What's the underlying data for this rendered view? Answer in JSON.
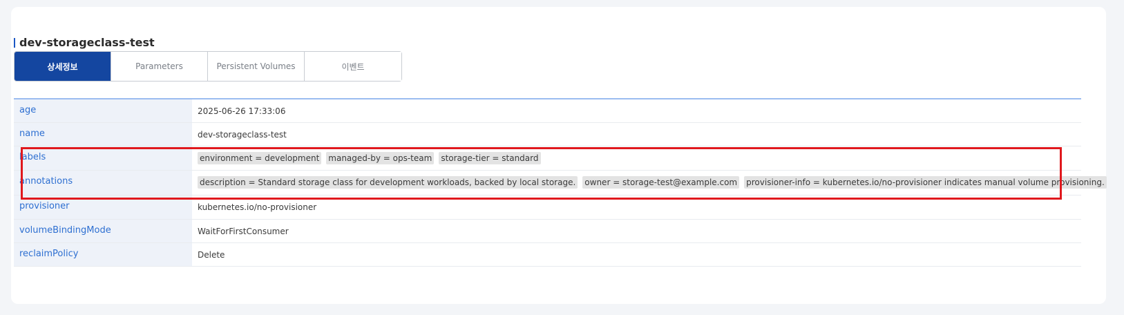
{
  "resource": {
    "title": "dev-storageclass-test"
  },
  "tabs": [
    {
      "label": "상세정보",
      "active": true
    },
    {
      "label": "Parameters",
      "active": false
    },
    {
      "label": "Persistent Volumes",
      "active": false
    },
    {
      "label": "이벤트",
      "active": false
    }
  ],
  "details": {
    "age": {
      "key": "age",
      "value": "2025-06-26 17:33:06"
    },
    "name": {
      "key": "name",
      "value": "dev-storageclass-test"
    },
    "labels": {
      "key": "labels",
      "items": [
        "environment = development",
        "managed-by = ops-team",
        "storage-tier = standard"
      ]
    },
    "annotations": {
      "key": "annotations",
      "items": [
        "description = Standard storage class for development workloads, backed by local storage.",
        "owner = storage-test@example.com",
        "provisioner-info = kubernetes.io/no-provisioner indicates manual volume provisioning."
      ]
    },
    "provisioner": {
      "key": "provisioner",
      "value": "kubernetes.io/no-provisioner"
    },
    "volumeBindingMode": {
      "key": "volumeBindingMode",
      "value": "WaitForFirstConsumer"
    },
    "reclaimPolicy": {
      "key": "reclaimPolicy",
      "value": "Delete"
    }
  },
  "colors": {
    "accent": "#1446a0",
    "key_text": "#2d6fd1",
    "highlight": "#e0181d"
  }
}
